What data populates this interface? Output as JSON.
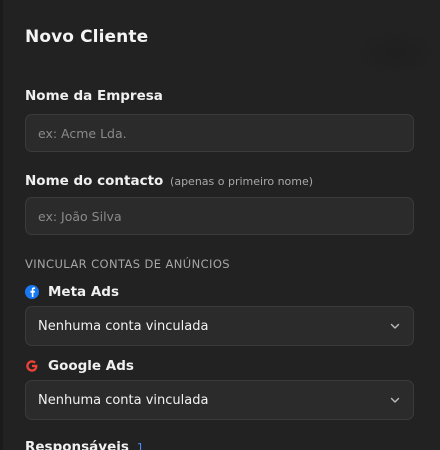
{
  "modal": {
    "title": "Novo Cliente"
  },
  "form": {
    "company": {
      "label": "Nome da Empresa",
      "placeholder": "ex: Acme Lda."
    },
    "contact": {
      "label": "Nome do contacto",
      "hint": "(apenas o primeiro nome)",
      "placeholder": "ex: João Silva"
    },
    "ad_accounts": {
      "heading": "VINCULAR CONTAS DE ANÚNCIOS",
      "meta": {
        "label": "Meta Ads",
        "selected": "Nenhuma conta vinculada"
      },
      "google": {
        "label": "Google Ads",
        "selected": "Nenhuma conta vinculada"
      }
    },
    "responsibles": {
      "label": "Responsáveis",
      "count": "1"
    }
  },
  "colors": {
    "background": "#222222",
    "field_bg": "#2b2b2b",
    "meta_blue": "#1877f2",
    "google_red": "#ea4335",
    "accent_blue": "#4f8bff"
  }
}
